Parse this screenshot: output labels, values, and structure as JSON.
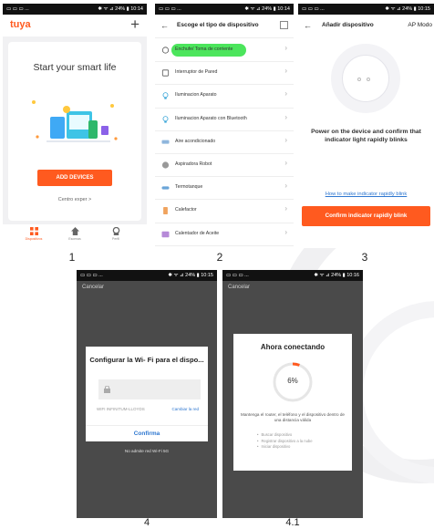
{
  "captions": [
    "1",
    "2",
    "3",
    "4",
    "4.1"
  ],
  "accent_color": "#ff5a1f",
  "link_color": "#2e77d0",
  "highlight_color": "#38e24a",
  "status": {
    "p1_right": "✱ ᯤ ⊿ 24% ▮ 10:14",
    "p2_right": "✱ ᯤ ⊿ 24% ▮ 10:14",
    "p3_right": "✱ ᯤ ⊿ 24% ▮ 10:15",
    "p4_right": "✱ ᯤ ⊿ 24% ▮ 10:15",
    "p41_right": "✱ ᯤ ⊿ 24% ▮ 10:16",
    "left": "▭ ▭ ▭ ..."
  },
  "home": {
    "logo": "tuya",
    "add_icon": "plus-icon",
    "headline": "Start your smart life",
    "add_devices": "ADD DEVICES",
    "expert": "Centro exper >",
    "tabs": [
      "Dispositivos",
      "Escenas",
      "Perfil"
    ]
  },
  "device_type": {
    "title": "Escoge el tipo de dispositivo",
    "items": [
      "Enchufe/ Toma de corriente",
      "Interruptor de Pared",
      "Iluminacion Aparato",
      "Iluminacion Aparato con Bluetooth",
      "Aire acondicionado",
      "Aspiradora Robot",
      "Termotanque",
      "Calefactor",
      "Calentador de Aceite"
    ]
  },
  "add_device": {
    "title": "Añadir dispositivo",
    "mode": "AP Modo",
    "message": "Power on the device and confirm that indicator light rapidly blinks",
    "link": "How to make indicator rapidly blink",
    "confirm": "Confirm indicator rapidly blink"
  },
  "wifi": {
    "cancel": "Cancelar",
    "title": "Configurar la Wi- Fi para el dispo...",
    "ssid": "WIFI INFINITUM-LLOYDS",
    "change": "Cambiar la red",
    "confirm": "Confirma",
    "note": "No admite red Wi-Fi 5G"
  },
  "connecting": {
    "cancel": "Cancelar",
    "title": "Ahora conectando",
    "progress": "6%",
    "progress_value": 0.06,
    "keep": "Mantenga el router, el teléfono y el dispositivo dentro de una distancia válida",
    "steps": [
      "Buscar dispositivo",
      "Registrar dispositivo a la nube",
      "Iniciar dispositivo"
    ]
  }
}
